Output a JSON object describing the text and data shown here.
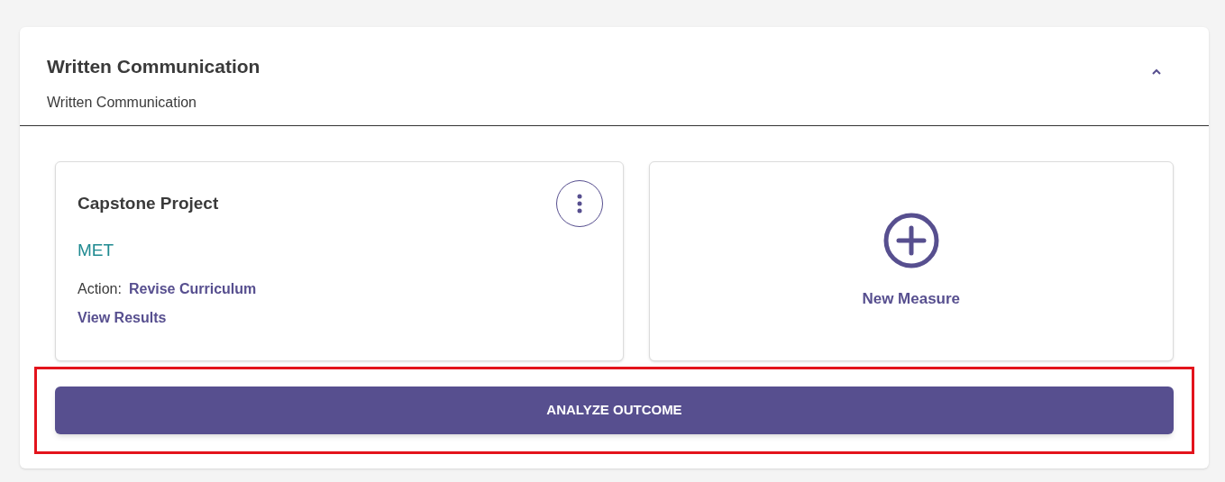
{
  "section": {
    "title": "Written Communication",
    "subtitle": "Written Communication",
    "expanded": true
  },
  "measures": [
    {
      "kind": "measure",
      "title": "Capstone Project",
      "status": "MET",
      "action_label": "Action:",
      "action": "Revise Curriculum",
      "link": "View Results"
    },
    {
      "kind": "new",
      "label": "New Measure"
    }
  ],
  "analyze_button": {
    "label": "ANALYZE OUTCOME",
    "highlighted": true
  }
}
